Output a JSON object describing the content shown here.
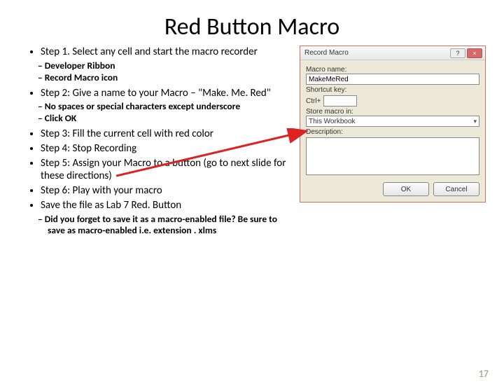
{
  "slide": {
    "title": "Red Button Macro",
    "page_number": "17"
  },
  "steps": {
    "s1": "Step 1. Select any cell and start the macro recorder",
    "s1a": "Developer Ribbon",
    "s1b": "Record Macro icon",
    "s2": "Step 2: Give a name to your Macro – \"Make. Me. Red\"",
    "s2a": "No spaces or special characters except underscore",
    "s2b": "Click OK",
    "s3": "Step 3: Fill the current cell with red color",
    "s4": "Step 4: Stop Recording",
    "s5": "Step 5: Assign your Macro to a button (go to next slide for these directions)",
    "s6": "Step 6: Play with your macro",
    "s7": "Save the file as Lab 7 Red. Button",
    "s7a": "Did you forget to save it as a macro-enabled file? Be sure to save as macro-enabled i.e. extension . xlms"
  },
  "dialog": {
    "title": "Record Macro",
    "macro_name_label": "Macro name:",
    "macro_name_value": "MakeMeRed",
    "shortcut_label": "Shortcut key:",
    "shortcut_prefix": "Ctrl+",
    "store_label": "Store macro in:",
    "store_value": "This Workbook",
    "description_label": "Description:",
    "ok": "OK",
    "cancel": "Cancel",
    "help": "?",
    "close": "×"
  }
}
